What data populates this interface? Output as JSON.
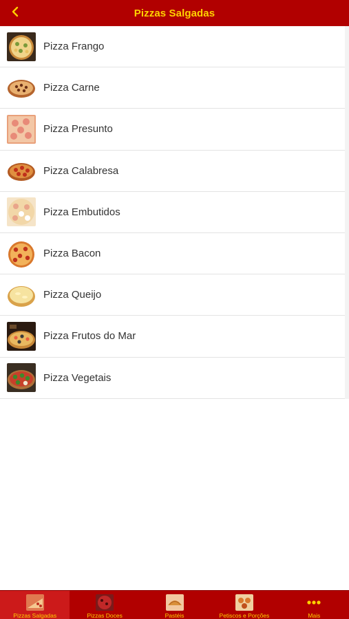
{
  "navbar": {
    "title": "Pizzas Salgadas",
    "back_icon": "chevron-left-icon",
    "accent": "#b10000",
    "title_color": "#ffd200"
  },
  "pizzas": [
    {
      "label": "Pizza Frango",
      "icon": "pizza-frango-thumbnail"
    },
    {
      "label": "Pizza Carne",
      "icon": "pizza-carne-thumbnail"
    },
    {
      "label": "Pizza Presunto",
      "icon": "pizza-presunto-thumbnail"
    },
    {
      "label": "Pizza Calabresa",
      "icon": "pizza-calabresa-thumbnail"
    },
    {
      "label": "Pizza Embutidos",
      "icon": "pizza-embutidos-thumbnail"
    },
    {
      "label": "Pizza Bacon",
      "icon": "pizza-bacon-thumbnail"
    },
    {
      "label": "Pizza Queijo",
      "icon": "pizza-queijo-thumbnail"
    },
    {
      "label": "Pizza Frutos do Mar",
      "icon": "pizza-frutos-do-mar-thumbnail"
    },
    {
      "label": "Pizza Vegetais",
      "icon": "pizza-vegetais-thumbnail"
    }
  ],
  "tabbar": {
    "tabs": [
      {
        "label": "Pizzas Salgadas",
        "icon": "pizza-slice-icon",
        "active": true
      },
      {
        "label": "Pizzas Doces",
        "icon": "sweet-pizza-icon",
        "active": false
      },
      {
        "label": "Pastéis",
        "icon": "pastel-icon",
        "active": false
      },
      {
        "label": "Petiscos e Porções",
        "icon": "snacks-icon",
        "active": false
      },
      {
        "label": "Mais",
        "icon": "more-dots-icon",
        "active": false
      }
    ]
  }
}
